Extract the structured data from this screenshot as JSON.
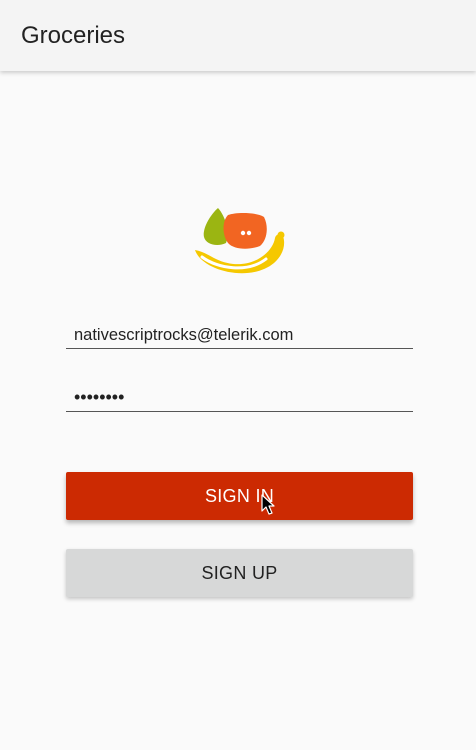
{
  "app_bar": {
    "title": "Groceries"
  },
  "logo": {
    "icon": "groceries-fruit-logo-icon"
  },
  "form": {
    "email_value": "nativescriptrocks@telerik.com",
    "password_value": "••••••••"
  },
  "buttons": {
    "sign_in_label": "SIGN IN",
    "sign_up_label": "SIGN UP"
  },
  "colors": {
    "primary": "#cc2a02",
    "secondary_button": "#d7d8d8",
    "app_bar": "#f4f4f4",
    "background": "#fafafa"
  }
}
